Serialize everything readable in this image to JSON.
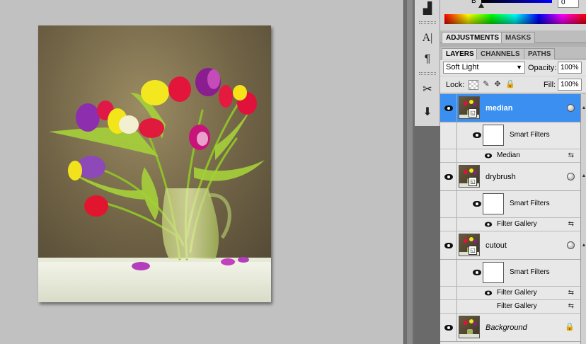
{
  "color": {
    "channel_label": "B",
    "channel_value": "0"
  },
  "adjustments_tabs": [
    {
      "label": "ADJUSTMENTS",
      "active": true
    },
    {
      "label": "MASKS",
      "active": false
    }
  ],
  "layers_tabs": [
    {
      "label": "LAYERS",
      "active": true
    },
    {
      "label": "CHANNELS",
      "active": false
    },
    {
      "label": "PATHS",
      "active": false
    }
  ],
  "blend_mode": {
    "value": "Soft Light"
  },
  "opacity": {
    "label": "Opacity:",
    "value": "100%"
  },
  "lock": {
    "label": "Lock:"
  },
  "fill": {
    "label": "Fill:",
    "value": "100%"
  },
  "layers": [
    {
      "name": "median",
      "selected": true,
      "smart_filters_label": "Smart Filters",
      "filters": [
        "Median"
      ]
    },
    {
      "name": "drybrush",
      "selected": false,
      "smart_filters_label": "Smart Filters",
      "filters": [
        "Filter Gallery"
      ]
    },
    {
      "name": "cutout",
      "selected": false,
      "smart_filters_label": "Smart Filters",
      "filters": [
        "Filter Gallery",
        "Filter Gallery"
      ]
    },
    {
      "name": "Background",
      "selected": false,
      "locked": true
    }
  ],
  "tool_icons": [
    "stamp-icon",
    "character-icon",
    "paragraph-icon",
    "tools-icon",
    "clone-source-icon"
  ],
  "colors": {
    "selected_layer": "#3b8ff0",
    "panel_bg": "#d4d4d4",
    "workspace_bg": "#c1c1c1"
  }
}
